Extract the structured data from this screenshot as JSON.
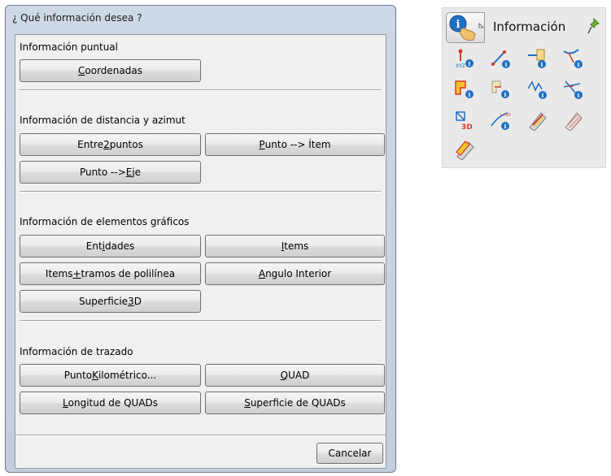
{
  "dialog": {
    "title": "¿ Qué información desea ?",
    "sections": [
      {
        "title": "Información puntual"
      },
      {
        "title": "Información de distancia y azimut"
      },
      {
        "title": "Información de elementos gráficos"
      },
      {
        "title": "Información de trazado"
      }
    ],
    "buttons": {
      "coordenadas": {
        "pre": "",
        "key": "C",
        "post": "oordenadas"
      },
      "entre2": {
        "pre": "Entre ",
        "key": "2",
        "post": " puntos"
      },
      "puntoItem": {
        "pre": "",
        "key": "P",
        "post": "unto  -->  Ítem"
      },
      "puntoEje": {
        "pre": "Punto  -->  ",
        "key": "E",
        "post": "je"
      },
      "entidades": {
        "pre": "Ent",
        "key": "i",
        "post": "dades"
      },
      "items": {
        "pre": "",
        "key": "I",
        "post": "tems"
      },
      "itemsTramos": {
        "pre": "Items ",
        "key": "+",
        "post": " tramos de polilínea"
      },
      "angulo": {
        "pre": "",
        "key": "A",
        "post": "ngulo Interior"
      },
      "superficie3d": {
        "pre": "Superficie ",
        "key": "3",
        "post": "D"
      },
      "pk": {
        "pre": "Punto ",
        "key": "K",
        "post": "ilométrico..."
      },
      "quad": {
        "pre": "",
        "key": "Q",
        "post": "UAD"
      },
      "longitud": {
        "pre": "",
        "key": "L",
        "post": "ongitud de QUADs"
      },
      "superficieQuads": {
        "pre": "",
        "key": "S",
        "post": "uperficie de QUADs"
      },
      "cancelar": {
        "pre": "Cancelar",
        "key": "",
        "post": ""
      }
    }
  },
  "toolbar": {
    "title": "Información",
    "icons": [
      "point-coordinates-xyz-icon",
      "distance-two-points-icon",
      "point-to-item-icon",
      "point-to-axis-icon",
      "entities-info-icon",
      "items-info-icon",
      "items-polyline-segments-icon",
      "interior-angle-icon",
      "surface-3d-icon",
      "kilometric-point-icon",
      "quad-icon",
      "quad-length-icon",
      "quad-surface-icon"
    ],
    "colors": {
      "accent_blue": "#1f6fc5",
      "red": "#d33a2a",
      "yellow": "#f5c42a"
    }
  }
}
